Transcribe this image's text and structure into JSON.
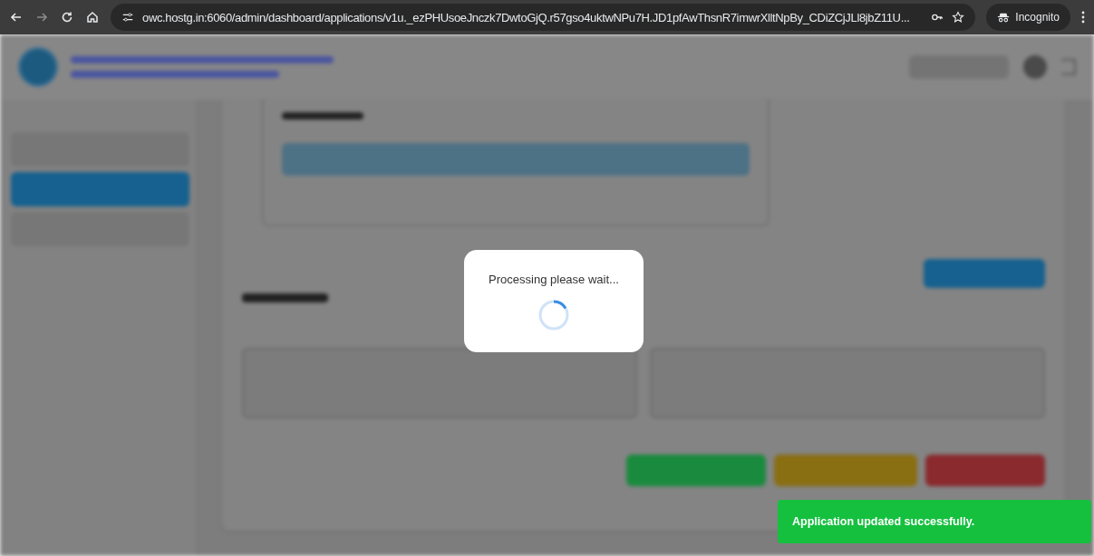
{
  "browser": {
    "url": "owc.hostg.in:6060/admin/dashboard/applications/v1u._ezPHUsoeJnczk7DwtoGjQ.r57gso4uktwNPu7H.JD1pfAwThsnR7imwrXlltNpBy_CDiZCjJLl8jbZ11U...",
    "incognito_label": "Incognito"
  },
  "sidebar": {
    "items": [
      {
        "selected": false
      },
      {
        "selected": true
      },
      {
        "selected": false
      }
    ]
  },
  "actions": [
    {
      "color": "#1a8a3e"
    },
    {
      "color": "#8a6e12"
    },
    {
      "color": "#8a2a2e"
    }
  ],
  "modal": {
    "message": "Processing please wait..."
  },
  "toast": {
    "message": "Application updated successfully."
  }
}
